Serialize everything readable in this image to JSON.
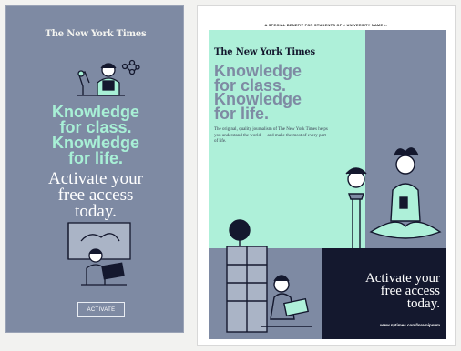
{
  "left_ad": {
    "logo": "The New York Times",
    "headline": [
      "Knowledge",
      "for class.",
      "Knowledge",
      "for life."
    ],
    "subline": [
      "Activate your",
      "free access",
      "today."
    ],
    "button_label": "ACTIVATE"
  },
  "right_ad": {
    "banner": "A SPECIAL BENEFIT FOR STUDENTS OF < UNIVERSITY NAME >.",
    "logo": "The New York Times",
    "headline": [
      "Knowledge",
      "for class.",
      "Knowledge",
      "for life."
    ],
    "body": "The original, quality journalism of The New York Times helps you understand the world — and make the most of every part of life.",
    "activate": [
      "Activate your",
      "free access",
      "today."
    ],
    "url": "www.nytimes.com/loremipsum"
  },
  "colors": {
    "slate": "#7e8aa3",
    "mint": "#aef0d9",
    "navy": "#14182e"
  }
}
